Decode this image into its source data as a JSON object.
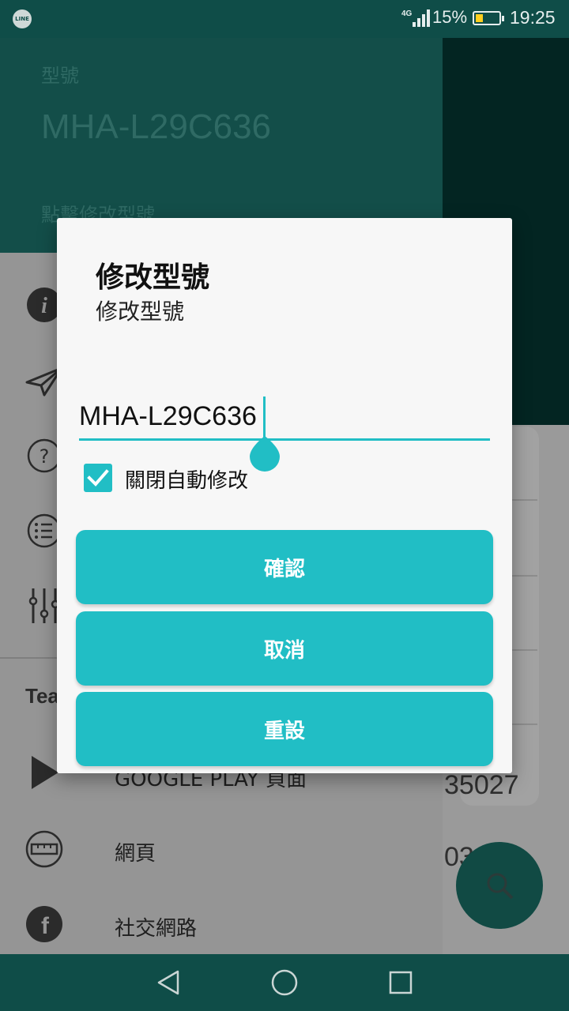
{
  "status_bar": {
    "app_icon_text": "LINE",
    "network": "4G",
    "battery_percent": "15%",
    "battery_level": 0.15,
    "time": "19:25"
  },
  "drawer": {
    "model_label": "型號",
    "model_value": "MHA-L29C636",
    "model_hint": "點擊修改型號",
    "section_title": "Tea",
    "items": [
      {
        "label": "GOOGLE PLAY 頁面",
        "icon": "play-store-icon"
      },
      {
        "label": "網頁",
        "icon": "web-icon"
      },
      {
        "label": "社交網路",
        "icon": "facebook-icon"
      }
    ]
  },
  "background_fragments": {
    "number_1": "35027",
    "number_2": "03"
  },
  "dialog": {
    "title": "修改型號",
    "subtitle": "修改型號",
    "input_value": "MHA-L29C636",
    "checkbox_label": "關閉自動修改",
    "checkbox_checked": true,
    "buttons": {
      "confirm": "確認",
      "cancel": "取消",
      "reset": "重設"
    }
  },
  "colors": {
    "accent": "#21bec5",
    "status_bar": "#0f4d48"
  }
}
